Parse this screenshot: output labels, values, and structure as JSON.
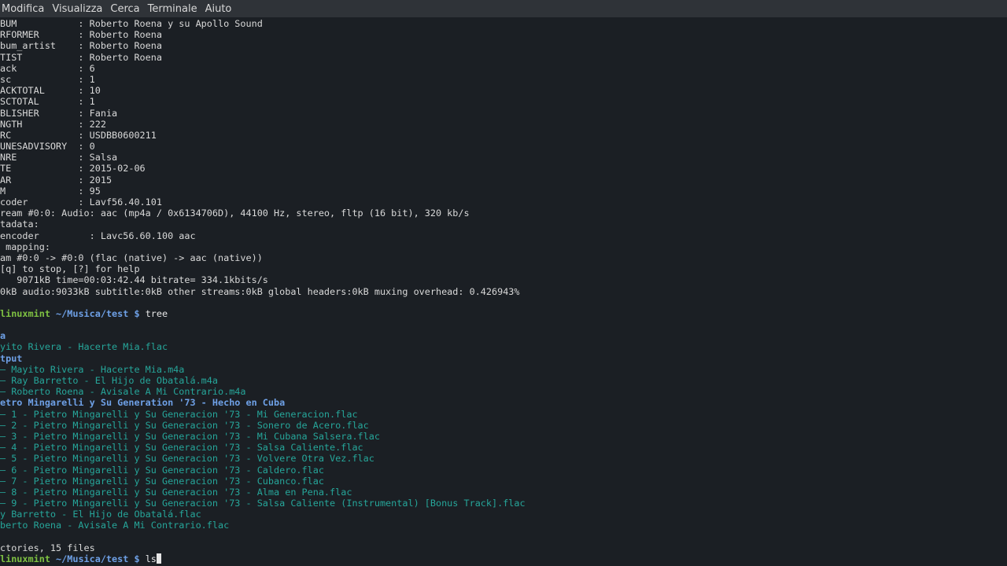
{
  "menubar": {
    "items": [
      "Modifica",
      "Visualizza",
      "Cerca",
      "Terminale",
      "Aiuto"
    ]
  },
  "colors": {
    "background": "#1b1f24",
    "menubar": "#2f3338",
    "text": "#d9d9d9",
    "file": "#26a69a",
    "directory": "#6ea0e6",
    "prompt_user": "#7fc242"
  },
  "terminal": {
    "metadata_lines": [
      "BUM           : Roberto Roena y su Apollo Sound",
      "RFORMER       : Roberto Roena",
      "bum_artist    : Roberto Roena",
      "TIST          : Roberto Roena",
      "ack           : 6",
      "sc            : 1",
      "ACKTOTAL      : 10",
      "SCTOTAL       : 1",
      "BLISHER       : Fania",
      "NGTH          : 222",
      "RC            : USDBB0600211",
      "UNESADVISORY  : 0",
      "NRE           : Salsa",
      "TE            : 2015-02-06",
      "AR            : 2015",
      "M             : 95",
      "coder         : Lavf56.40.101",
      "ream #0:0: Audio: aac (mp4a / 0x6134706D), 44100 Hz, stereo, fltp (16 bit), 320 kb/s",
      "tadata:",
      "encoder         : Lavc56.60.100 aac",
      " mapping:",
      "am #0:0 -> #0:0 (flac (native) -> aac (native))",
      "[q] to stop, [?] for help",
      "   9071kB time=00:03:42.44 bitrate= 334.1kbits/s",
      "0kB audio:9033kB subtitle:0kB other streams:0kB global headers:0kB muxing overhead: 0.426943%",
      ""
    ],
    "prompt1": {
      "user": "linuxmint",
      "path": "~/Musica/test",
      "symbol": "$",
      "command": "tree"
    },
    "tree_lines": [
      {
        "text": "",
        "kind": "plain"
      },
      {
        "text": "a",
        "kind": "dir"
      },
      {
        "text": "yito Rivera - Hacerte Mia.flac",
        "kind": "file"
      },
      {
        "text": "tput",
        "kind": "dir"
      },
      {
        "text": "— Mayito Rivera - Hacerte Mia.m4a",
        "kind": "file"
      },
      {
        "text": "— Ray Barretto - El Hijo de Obatalá.m4a",
        "kind": "file"
      },
      {
        "text": "— Roberto Roena - Avisale A Mi Contrario.m4a",
        "kind": "file"
      },
      {
        "text": "etro Mingarelli y Su Generation '73 - Hecho en Cuba",
        "kind": "dir"
      },
      {
        "text": "— 1 - Pietro Mingarelli y Su Generacion '73 - Mi Generacion.flac",
        "kind": "file"
      },
      {
        "text": "— 2 - Pietro Mingarelli y Su Generacion '73 - Sonero de Acero.flac",
        "kind": "file"
      },
      {
        "text": "— 3 - Pietro Mingarelli y Su Generacion '73 - Mi Cubana Salsera.flac",
        "kind": "file"
      },
      {
        "text": "— 4 - Pietro Mingarelli y Su Generacion '73 - Salsa Caliente.flac",
        "kind": "file"
      },
      {
        "text": "— 5 - Pietro Mingarelli y Su Generacion '73 - Volvere Otra Vez.flac",
        "kind": "file"
      },
      {
        "text": "— 6 - Pietro Mingarelli y Su Generacion '73 - Caldero.flac",
        "kind": "file"
      },
      {
        "text": "— 7 - Pietro Mingarelli y Su Generacion '73 - Cubanco.flac",
        "kind": "file"
      },
      {
        "text": "— 8 - Pietro Mingarelli y Su Generacion '73 - Alma en Pena.flac",
        "kind": "file"
      },
      {
        "text": "— 9 - Pietro Mingarelli y Su Generacion '73 - Salsa Caliente (Instrumental) [Bonus Track].flac",
        "kind": "file"
      },
      {
        "text": "y Barretto - El Hijo de Obatalá.flac",
        "kind": "file"
      },
      {
        "text": "berto Roena - Avisale A Mi Contrario.flac",
        "kind": "file"
      },
      {
        "text": "",
        "kind": "plain"
      },
      {
        "text": "ctories, 15 files",
        "kind": "plain"
      }
    ],
    "prompt2": {
      "user": "linuxmint",
      "path": "~/Musica/test",
      "symbol": "$",
      "command": "ls"
    }
  }
}
